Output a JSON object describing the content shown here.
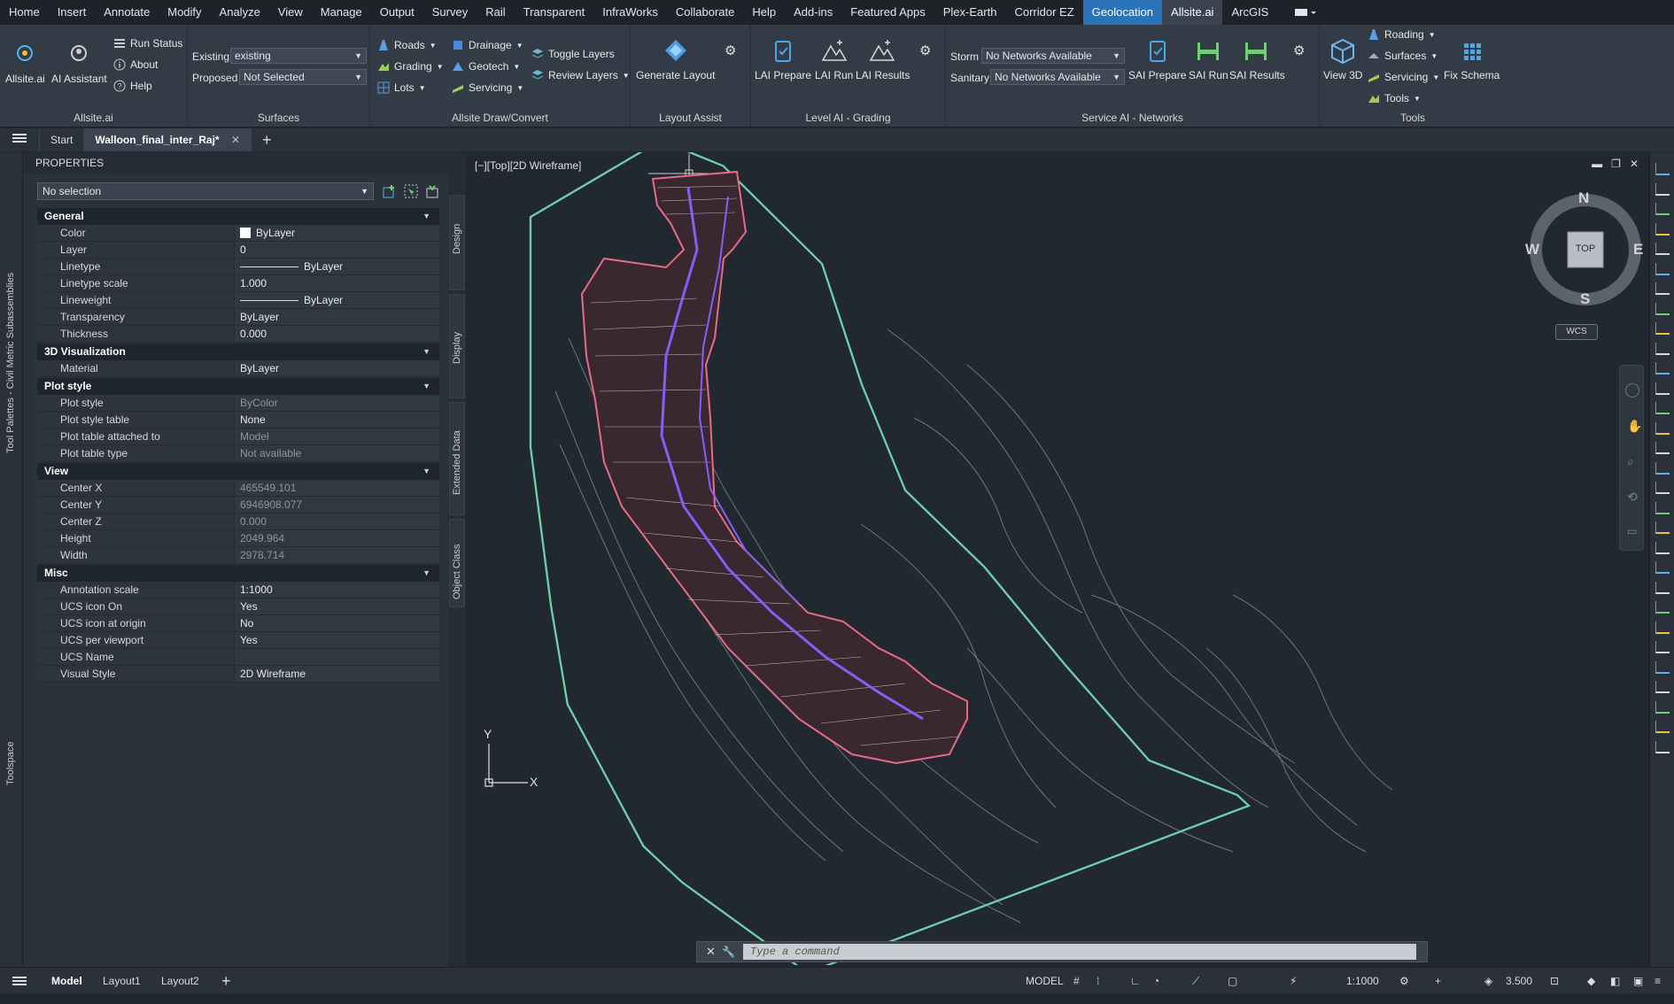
{
  "menu": {
    "tabs": [
      "Home",
      "Insert",
      "Annotate",
      "Modify",
      "Analyze",
      "View",
      "Manage",
      "Output",
      "Survey",
      "Rail",
      "Transparent",
      "InfraWorks",
      "Collaborate",
      "Help",
      "Add-ins",
      "Featured Apps",
      "Plex-Earth",
      "Corridor EZ",
      "Geolocation",
      "Allsite.ai",
      "ArcGIS"
    ],
    "active_tab": "Geolocation",
    "highlight_tab": "Allsite.ai"
  },
  "ribbon": {
    "allsite_panel": {
      "title": "Allsite.ai",
      "allsite_label": "Allsite.ai",
      "assistant_label": "AI Assistant",
      "run_status": "Run Status",
      "about": "About",
      "help": "Help"
    },
    "surfaces_panel": {
      "title": "Surfaces",
      "existing_label": "Existing",
      "existing_value": "existing",
      "proposed_label": "Proposed",
      "proposed_value": "Not Selected"
    },
    "draw_panel": {
      "title": "Allsite Draw/Convert",
      "roads": "Roads",
      "grading": "Grading",
      "lots": "Lots",
      "drainage": "Drainage",
      "geotech": "Geotech",
      "servicing": "Servicing",
      "toggle_layers": "Toggle Layers",
      "review_layers": "Review Layers"
    },
    "layout_panel": {
      "title": "Layout Assist",
      "generate_layout": "Generate Layout"
    },
    "level_panel": {
      "title": "Level AI - Grading",
      "prepare": "LAI Prepare",
      "run": "LAI Run",
      "results": "LAI Results"
    },
    "service_panel": {
      "title": "Service AI - Networks",
      "storm_label": "Storm",
      "storm_value": "No Networks Available",
      "sanitary_label": "Sanitary",
      "sanitary_value": "No Networks Available",
      "prepare": "SAI Prepare",
      "run": "SAI Run",
      "results": "SAI Results"
    },
    "tools_panel": {
      "title": "Tools",
      "view3d": "View 3D",
      "roading": "Roading",
      "surfaces": "Surfaces",
      "servicing": "Servicing",
      "tools": "Tools",
      "fix_schema": "Fix Schema"
    }
  },
  "doc_tabs": {
    "start": "Start",
    "current": "Walloon_final_inter_Raj*"
  },
  "left_palettes": {
    "tool_palettes": "Tool Palettes - Civil Metric Subassemblies",
    "toolspace": "Toolspace"
  },
  "properties": {
    "title": "PROPERTIES",
    "selection": "No selection",
    "side_tabs": [
      "Design",
      "Display",
      "Extended Data",
      "Object Class"
    ],
    "sections": [
      {
        "name": "General",
        "rows": [
          {
            "k": "Color",
            "v": "ByLayer",
            "kind": "color"
          },
          {
            "k": "Layer",
            "v": "0"
          },
          {
            "k": "Linetype",
            "v": "ByLayer",
            "kind": "line"
          },
          {
            "k": "Linetype scale",
            "v": "1.000"
          },
          {
            "k": "Lineweight",
            "v": "ByLayer",
            "kind": "line"
          },
          {
            "k": "Transparency",
            "v": "ByLayer"
          },
          {
            "k": "Thickness",
            "v": "0.000"
          }
        ]
      },
      {
        "name": "3D Visualization",
        "rows": [
          {
            "k": "Material",
            "v": "ByLayer"
          }
        ]
      },
      {
        "name": "Plot style",
        "rows": [
          {
            "k": "Plot style",
            "v": "ByColor",
            "ro": true
          },
          {
            "k": "Plot style table",
            "v": "None"
          },
          {
            "k": "Plot table attached to",
            "v": "Model",
            "ro": true
          },
          {
            "k": "Plot table type",
            "v": "Not available",
            "ro": true
          }
        ]
      },
      {
        "name": "View",
        "rows": [
          {
            "k": "Center X",
            "v": "465549.101",
            "ro": true
          },
          {
            "k": "Center Y",
            "v": "6946908.077",
            "ro": true
          },
          {
            "k": "Center Z",
            "v": "0.000",
            "ro": true
          },
          {
            "k": "Height",
            "v": "2049.964",
            "ro": true
          },
          {
            "k": "Width",
            "v": "2978.714",
            "ro": true
          }
        ]
      },
      {
        "name": "Misc",
        "rows": [
          {
            "k": "Annotation scale",
            "v": "1:1000"
          },
          {
            "k": "UCS icon On",
            "v": "Yes"
          },
          {
            "k": "UCS icon at origin",
            "v": "No"
          },
          {
            "k": "UCS per viewport",
            "v": "Yes"
          },
          {
            "k": "UCS Name",
            "v": ""
          },
          {
            "k": "Visual Style",
            "v": "2D Wireframe"
          }
        ]
      }
    ]
  },
  "viewport": {
    "label": "[−][Top][2D Wireframe]",
    "compass": {
      "n": "N",
      "s": "S",
      "e": "E",
      "w": "W",
      "top": "TOP"
    },
    "wcs": "WCS",
    "ucs_x": "X",
    "ucs_y": "Y"
  },
  "command": {
    "placeholder": "Type a command"
  },
  "status": {
    "model_tab": "Model",
    "layout1": "Layout1",
    "layout2": "Layout2",
    "model_label": "MODEL",
    "scale": "1:1000",
    "value": "3.500"
  },
  "colors": {
    "accent": "#2b73b8",
    "boundary": "#6fcfa8",
    "lots": "#e86a86",
    "roads": "#8a5cf6"
  }
}
